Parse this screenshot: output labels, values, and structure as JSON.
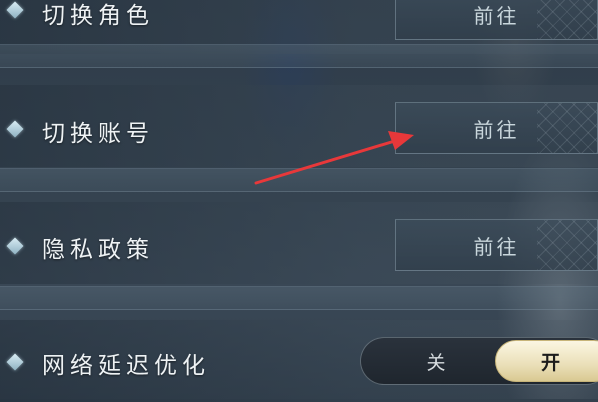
{
  "settings": {
    "rows": [
      {
        "label": "切换角色",
        "button": "前往"
      },
      {
        "label": "切换账号",
        "button": "前往"
      },
      {
        "label": "隐私政策",
        "button": "前往"
      },
      {
        "label": "网络延迟优化"
      }
    ],
    "toggle": {
      "off_label": "关",
      "on_label": "开",
      "state": "开"
    }
  },
  "colors": {
    "annotation_arrow": "#e8383a",
    "toggle_on": "#f3ecd0",
    "label_text": "#eef2f4"
  },
  "icons": [
    "diamond-bullet-icon",
    "red-annotation-arrow"
  ]
}
